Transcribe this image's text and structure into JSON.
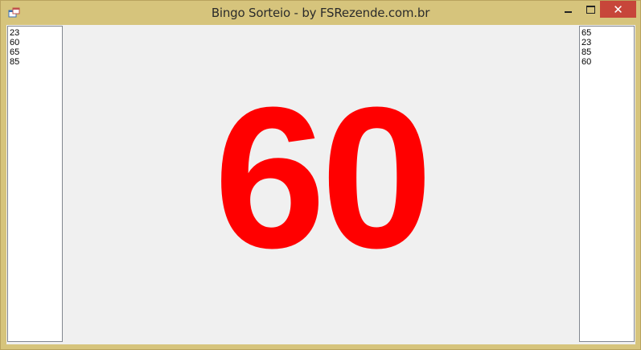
{
  "window": {
    "title": "Bingo Sorteio - by FSRezende.com.br",
    "close_glyph": "✕",
    "icons": {
      "app": "app-window-icon",
      "minimize": "minimize-icon",
      "maximize": "maximize-icon",
      "close": "close-icon"
    }
  },
  "left_list": {
    "items": [
      "23",
      "60",
      "65",
      "85"
    ]
  },
  "right_list": {
    "items": [
      "65",
      "23",
      "85",
      "60"
    ]
  },
  "current_number": "60",
  "colors": {
    "number": "#ff0000",
    "title_bar": "#d6c47c",
    "close_button": "#c7463a"
  }
}
